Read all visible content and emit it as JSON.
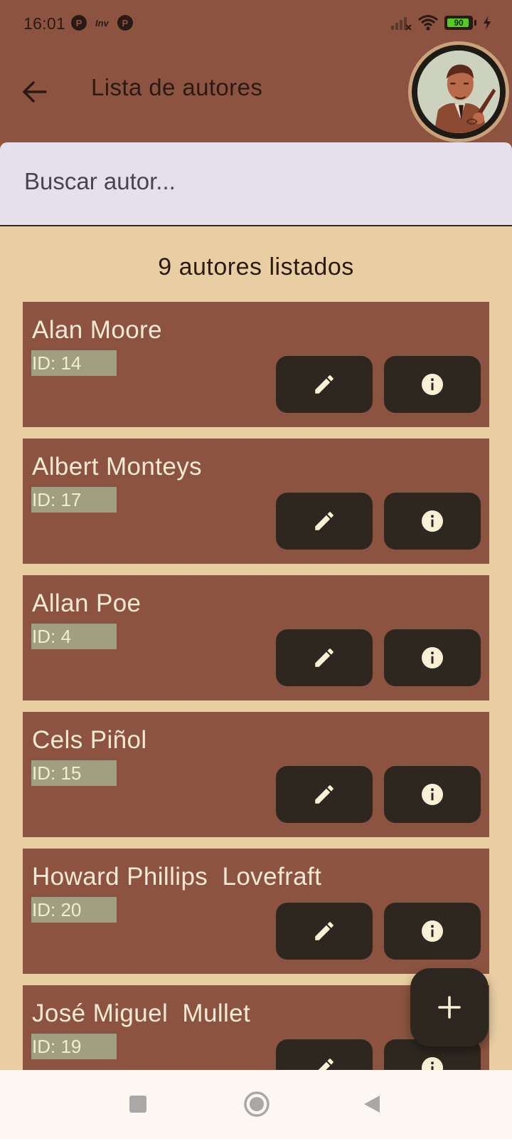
{
  "status_bar": {
    "time": "16:01",
    "left_icons": [
      "p-circle-icon",
      "inv-text-icon",
      "p-circle-icon"
    ],
    "inv_text": "Inv",
    "battery_level": "90",
    "right_icons": [
      "signal-off-icon",
      "wifi-icon",
      "battery-icon",
      "charging-bolt-icon"
    ]
  },
  "app_bar": {
    "title": "Lista de autores",
    "back_icon": "arrow-left-icon",
    "avatar": "vintage-writer-illustration"
  },
  "search": {
    "placeholder": "Buscar autor...",
    "value": ""
  },
  "list": {
    "count_label": "9 autores listados",
    "authors": [
      {
        "name": "Alan Moore",
        "id_label": "ID: 14"
      },
      {
        "name": "Albert Monteys",
        "id_label": "ID: 17"
      },
      {
        "name": "Allan Poe",
        "id_label": "ID: 4"
      },
      {
        "name": "Cels Piñol",
        "id_label": "ID: 15"
      },
      {
        "name": "Howard Phillips  Lovefraft",
        "id_label": "ID: 20"
      },
      {
        "name": "José Miguel  Mullet",
        "id_label": "ID: 19"
      }
    ],
    "card_buttons": {
      "edit_icon": "pencil-icon",
      "info_icon": "info-icon"
    }
  },
  "fab": {
    "icon": "plus-icon"
  },
  "nav_bar": {
    "icons": [
      "recents-square-icon",
      "home-circle-icon",
      "back-triangle-icon"
    ]
  },
  "colors": {
    "app_bar_bg": "#8c5440",
    "content_bg": "#e9cda3",
    "card_bg": "#8c5440",
    "button_bg": "#2e2720",
    "icon_cream": "#fbefd5",
    "id_badge_bg": "#a0a080",
    "search_bg": "#e6e0ec"
  }
}
